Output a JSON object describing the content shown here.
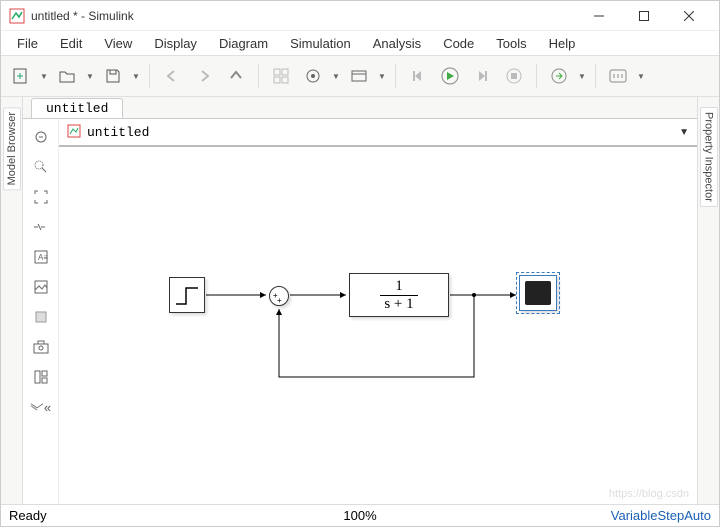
{
  "window": {
    "title": "untitled * - Simulink"
  },
  "menu": [
    "File",
    "Edit",
    "View",
    "Display",
    "Diagram",
    "Simulation",
    "Analysis",
    "Code",
    "Tools",
    "Help"
  ],
  "tabs": [
    {
      "label": "untitled"
    }
  ],
  "breadcrumb": {
    "model": "untitled"
  },
  "sidebar": {
    "left": "Model Browser",
    "right": "Property Inspector"
  },
  "blocks": {
    "tf": {
      "num": "1",
      "den": "s + 1"
    },
    "sum": {
      "signs": "++"
    }
  },
  "status": {
    "left": "Ready",
    "zoom": "100%",
    "solver": "VariableStepAuto"
  },
  "watermark": "https://blog.csdn"
}
